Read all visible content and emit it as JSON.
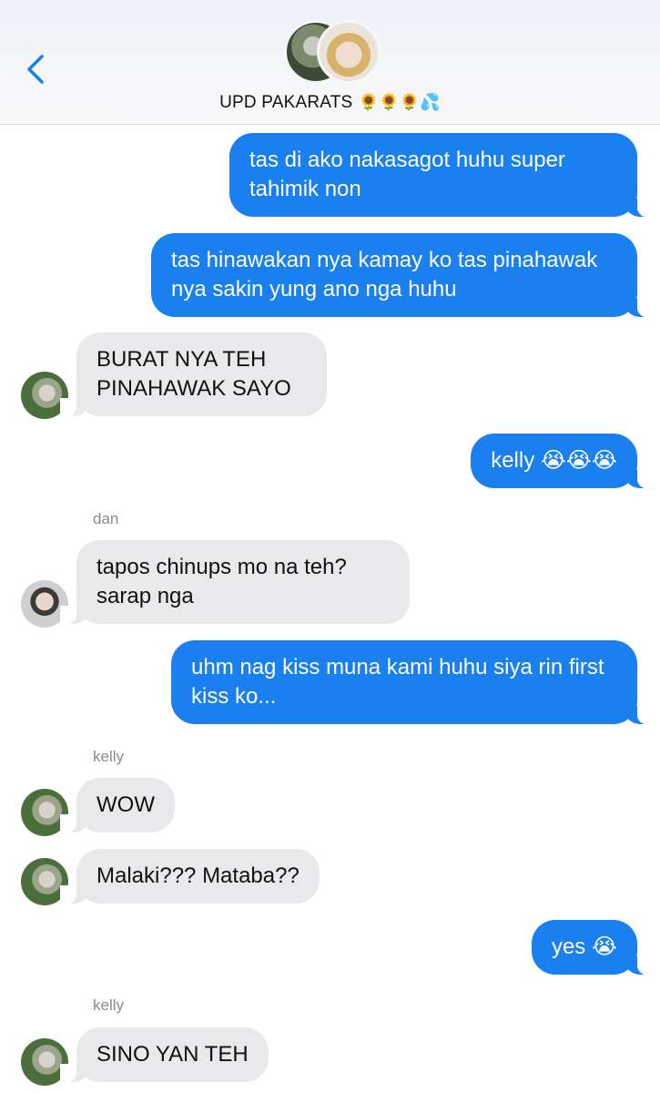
{
  "header": {
    "back_icon": "chevron-left-icon",
    "group_name": "UPD PAKARATS",
    "group_emojis": "🌻🌻🌻💦",
    "accent": "#1a80f0"
  },
  "messages": [
    {
      "dir": "out",
      "text": "tas di ako nakasagot huhu super tahimik non"
    },
    {
      "dir": "out",
      "text": "tas hinawakan nya kamay ko tas pinahawak nya sakin yung ano nga huhu"
    },
    {
      "dir": "in",
      "text": "BURAT NYA TEH PINAHAWAK SAYO"
    },
    {
      "dir": "out",
      "text": "kelly 😭😭😭"
    },
    {
      "dir": "in",
      "sender": "dan",
      "text": "tapos chinups mo na teh? sarap nga"
    },
    {
      "dir": "out",
      "text": "uhm nag kiss muna kami huhu siya rin first kiss ko..."
    },
    {
      "dir": "in",
      "sender": "kelly",
      "text": "WOW"
    },
    {
      "dir": "in",
      "text": "Malaki??? Mataba??"
    },
    {
      "dir": "out",
      "text": "yes 😭"
    },
    {
      "dir": "in",
      "sender": "kelly",
      "text": "SINO YAN TEH"
    }
  ],
  "colors": {
    "outgoing_bubble": "#1a80f0",
    "incoming_bubble": "#e9e9eb",
    "sender_label": "#8a8a8e"
  }
}
